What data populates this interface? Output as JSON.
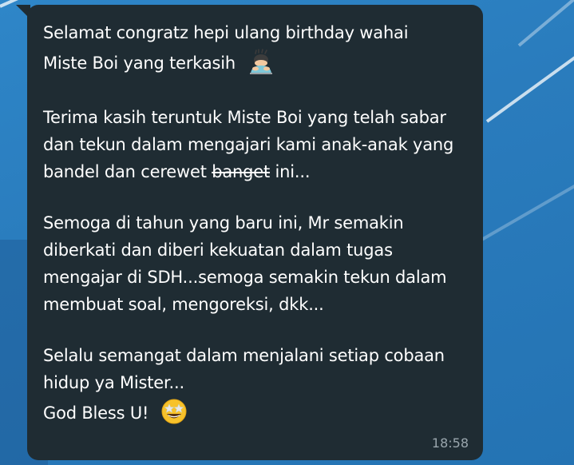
{
  "message": {
    "line_1": "Selamat congratz hepi ulang birthday wahai",
    "line_2": "Miste Boi yang terkasih",
    "line_2_emoji": "bowing-person-emoji",
    "line_3": "Terima kasih teruntuk Miste Boi yang telah sabar",
    "line_4": "dan tekun dalam mengajari kami anak-anak yang",
    "line_5_before": "bandel dan cerewet ",
    "line_5_strike": "banget",
    "line_5_after": " ini...",
    "line_6": "Semoga di tahun yang baru ini, Mr semakin",
    "line_7": "diberkati dan diberi kekuatan dalam tugas",
    "line_8": "mengajar di SDH...semoga semakin tekun dalam",
    "line_9": "membuat soal, mengoreksi, dkk...",
    "line_10": "Selalu semangat dalam menjalani setiap cobaan",
    "line_11": "hidup ya Mister...",
    "line_12": "God Bless U!",
    "line_12_emoji": "star-struck-emoji",
    "time": "18:58"
  },
  "colors": {
    "bubble": "#1f2c33",
    "text": "#ffffff",
    "timestamp": "#9aa6ad",
    "wallpaper": "#2a7cbd"
  }
}
